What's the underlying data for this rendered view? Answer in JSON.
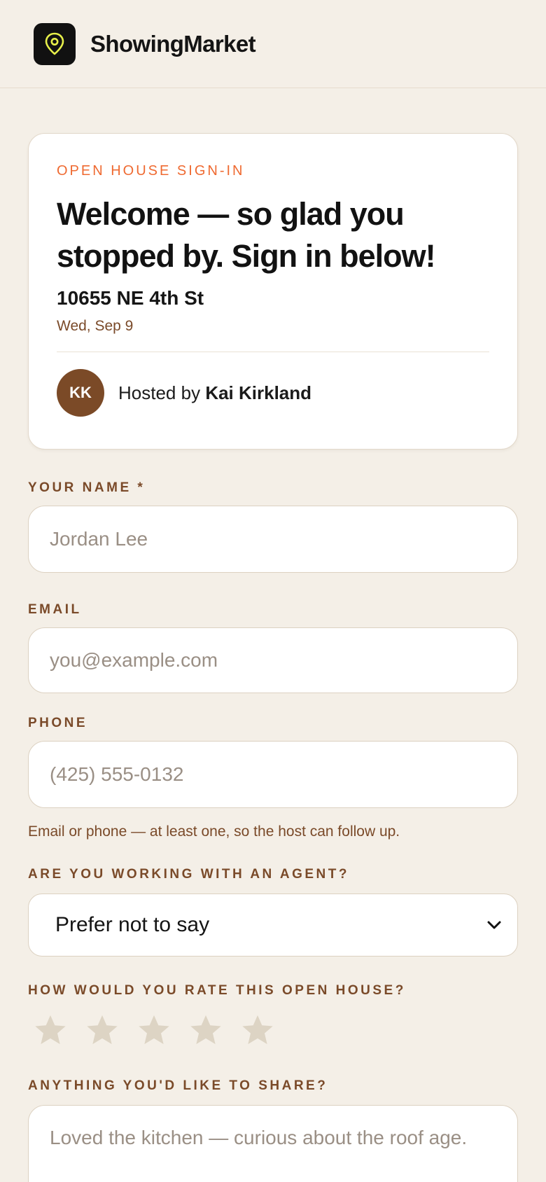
{
  "header": {
    "brand": "ShowingMarket",
    "logo_icon": "map-pin-icon"
  },
  "card": {
    "eyebrow": "OPEN HOUSE SIGN-IN",
    "headline": "Welcome — so glad you stopped by. Sign in below!",
    "address": "10655 NE 4th St",
    "date": "Wed, Sep 9",
    "host": {
      "initials": "KK",
      "prefix": "Hosted by",
      "name": "Kai Kirkland"
    }
  },
  "form": {
    "name": {
      "label": "YOUR NAME *",
      "placeholder": "Jordan Lee",
      "value": ""
    },
    "email": {
      "label": "EMAIL",
      "placeholder": "you@example.com",
      "value": ""
    },
    "phone": {
      "label": "PHONE",
      "placeholder": "(425) 555-0132",
      "value": ""
    },
    "contact_hint": "Email or phone — at least one, so the host can follow up.",
    "agent": {
      "label": "ARE YOU WORKING WITH AN AGENT?",
      "selected": "Prefer not to say"
    },
    "rating": {
      "label": "HOW WOULD YOU RATE THIS OPEN HOUSE?",
      "max": 5,
      "value": 0
    },
    "comments": {
      "label": "ANYTHING YOU'D LIKE TO SHARE?",
      "placeholder": "Loved the kitchen — curious about the roof age."
    }
  },
  "colors": {
    "background": "#f4efe7",
    "accent": "#ef6a31",
    "label_brown": "#7a4a29",
    "star_empty": "#ddd4c4",
    "logo_pin": "#e7f04a"
  }
}
